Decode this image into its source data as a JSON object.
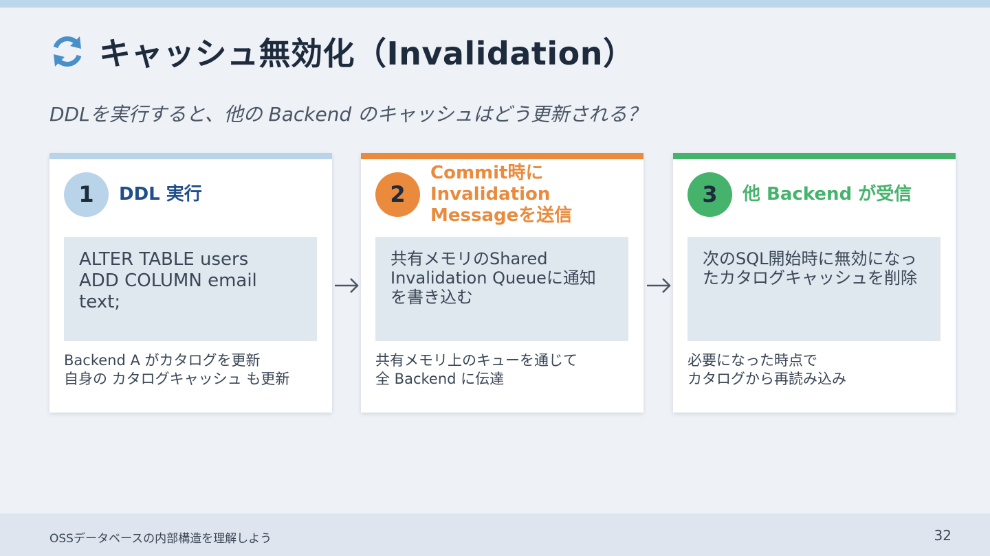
{
  "header": {
    "title": "キャッシュ無効化（Invalidation）",
    "icon": "refresh-icon",
    "icon_color": "#4a90c8",
    "subtitle": "DDLを実行すると、他の Backend のキャッシュはどう更新される？"
  },
  "steps": [
    {
      "number": "1",
      "title": "DDL 実行",
      "accent_color": "#b9d4e9",
      "circle_color": "#b9d4e9",
      "title_color": "#1f4e8c",
      "detail": "ALTER TABLE users\nADD COLUMN email\ntext;",
      "note": "Backend A がカタログを更新\n自身の カタログキャッシュ も更新"
    },
    {
      "number": "2",
      "title": "Commit時に\nInvalidation\nMessageを送信",
      "accent_color": "#ea8a3c",
      "circle_color": "#ea8a3c",
      "title_color": "#ea8a3c",
      "detail": "共有メモリのShared\nInvalidation Queueに通知\nを書き込む",
      "note": "共有メモリ上のキューを通じて\n全 Backend に伝達"
    },
    {
      "number": "3",
      "title": "他 Backend が受信",
      "accent_color": "#45b36b",
      "circle_color": "#45b36b",
      "title_color": "#45b36b",
      "detail": "次のSQL開始時に無効になっ\nたカタログキャッシュを削除",
      "note": "必要になった時点で\nカタログから再読み込み"
    }
  ],
  "arrows": [
    "arrow-right-icon",
    "arrow-right-icon"
  ],
  "footer": {
    "text": "OSSデータベースの内部構造を理解しよう",
    "page": "32"
  }
}
